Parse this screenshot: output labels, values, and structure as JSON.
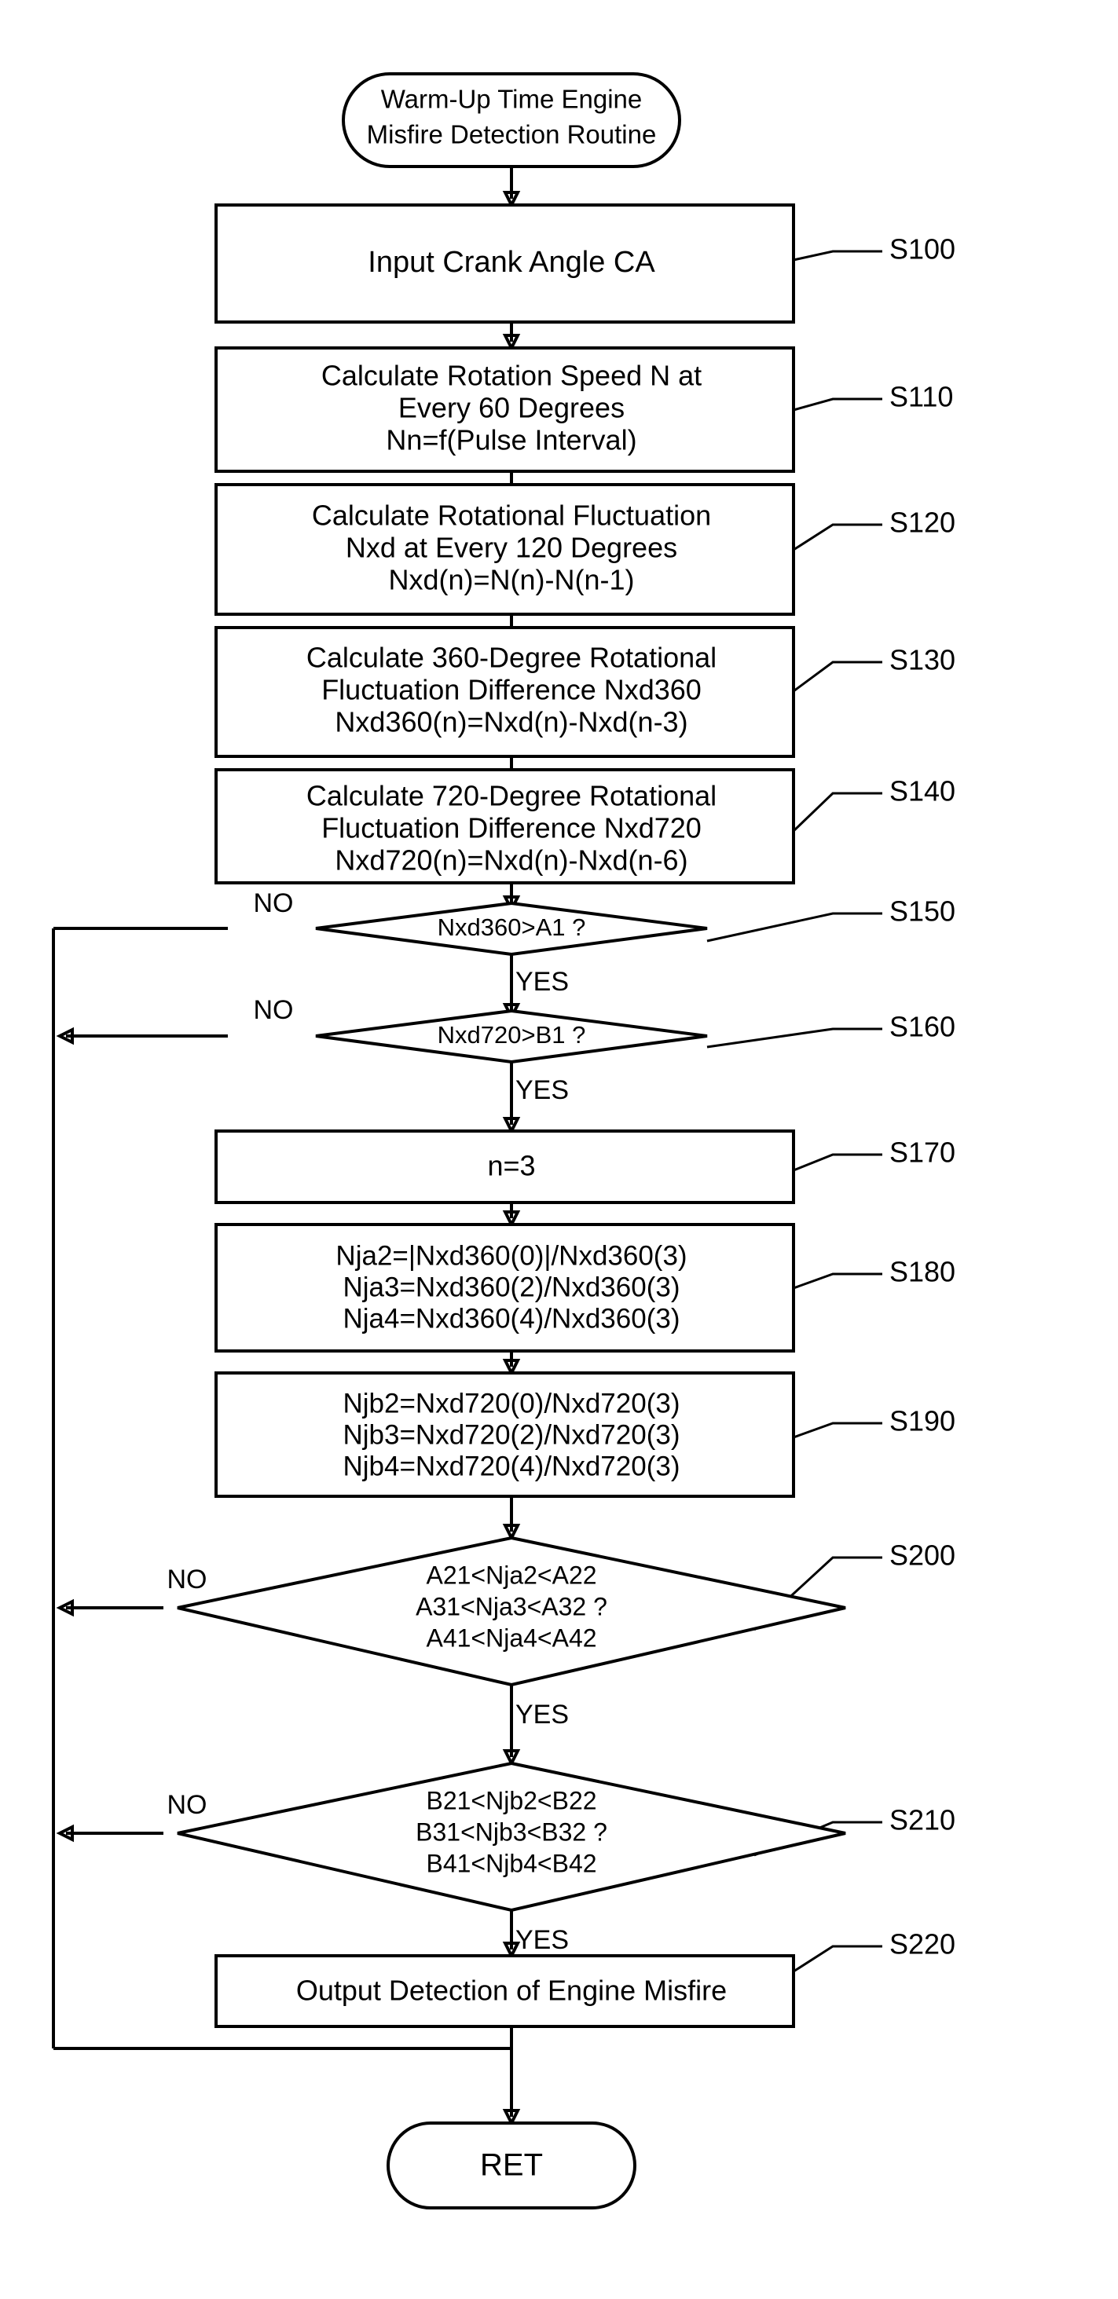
{
  "diagram": {
    "title": "Warm-Up Time Engine Misfire Detection Routine",
    "start": {
      "id": "start",
      "lines": [
        "Warm-Up Time Engine",
        "Misfire Detection Routine"
      ]
    },
    "end": {
      "id": "ret",
      "lines": [
        "RET"
      ]
    },
    "steps": [
      {
        "id": "S100",
        "label": "S100",
        "type": "process",
        "lines": [
          "Input Crank Angle CA"
        ]
      },
      {
        "id": "S110",
        "label": "S110",
        "type": "process",
        "lines": [
          "Calculate Rotation Speed N at",
          "Every 60 Degrees",
          "Nn=f(Pulse Interval)"
        ]
      },
      {
        "id": "S120",
        "label": "S120",
        "type": "process",
        "lines": [
          "Calculate Rotational Fluctuation",
          "Nxd at Every 120 Degrees",
          "Nxd(n)=N(n)-N(n-1)"
        ]
      },
      {
        "id": "S130",
        "label": "S130",
        "type": "process",
        "lines": [
          "Calculate 360-Degree Rotational",
          "Fluctuation Difference Nxd360",
          "Nxd360(n)=Nxd(n)-Nxd(n-3)"
        ]
      },
      {
        "id": "S140",
        "label": "S140",
        "type": "process",
        "lines": [
          "Calculate 720-Degree Rotational",
          "Fluctuation Difference Nxd720",
          "Nxd720(n)=Nxd(n)-Nxd(n-6)"
        ]
      },
      {
        "id": "S150",
        "label": "S150",
        "type": "decision",
        "lines": [
          "Nxd360>A1 ?"
        ],
        "no_label": "NO",
        "yes_label": "YES"
      },
      {
        "id": "S160",
        "label": "S160",
        "type": "decision",
        "lines": [
          "Nxd720>B1 ?"
        ],
        "no_label": "NO",
        "yes_label": "YES"
      },
      {
        "id": "S170",
        "label": "S170",
        "type": "process",
        "lines": [
          "n=3"
        ]
      },
      {
        "id": "S180",
        "label": "S180",
        "type": "process",
        "lines": [
          "Nja2=|Nxd360(0)|/Nxd360(3)",
          "Nja3=Nxd360(2)/Nxd360(3)",
          "Nja4=Nxd360(4)/Nxd360(3)"
        ]
      },
      {
        "id": "S190",
        "label": "S190",
        "type": "process",
        "lines": [
          "Njb2=Nxd720(0)/Nxd720(3)",
          "Njb3=Nxd720(2)/Nxd720(3)",
          "Njb4=Nxd720(4)/Nxd720(3)"
        ]
      },
      {
        "id": "S200",
        "label": "S200",
        "type": "decision",
        "lines": [
          "A21<Nja2<A22",
          "A31<Nja3<A32 ?",
          "A41<Nja4<A42"
        ],
        "no_label": "NO",
        "yes_label": "YES"
      },
      {
        "id": "S210",
        "label": "S210",
        "type": "decision",
        "lines": [
          "B21<Njb2<B22",
          "B31<Njb3<B32 ?",
          "B41<Njb4<B42"
        ],
        "no_label": "NO",
        "yes_label": "YES"
      },
      {
        "id": "S220",
        "label": "S220",
        "type": "process",
        "lines": [
          "Output Detection of Engine Misfire"
        ]
      }
    ]
  }
}
